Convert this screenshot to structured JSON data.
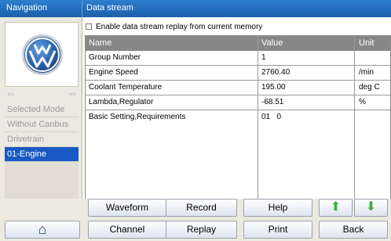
{
  "header": {
    "nav_title": "Navigation",
    "main_title": "Data stream"
  },
  "sidebar": {
    "logo": "vw-logo",
    "items": [
      {
        "label": "Selected Mode",
        "active": false
      },
      {
        "label": "Without Canbus",
        "active": false
      },
      {
        "label": "Drivetrain",
        "active": false
      },
      {
        "label": "01-Engine",
        "active": true
      }
    ]
  },
  "replay_option": {
    "label": "Enable data stream replay from current memory",
    "checked": false
  },
  "table": {
    "columns": [
      "Name",
      "Value",
      "Unit"
    ],
    "rows": [
      {
        "name": "Group Number",
        "value": "1",
        "unit": ""
      },
      {
        "name": "Engine Speed",
        "value": "2760.40",
        "unit": "/min"
      },
      {
        "name": "Coolant Temperature",
        "value": "195.00",
        "unit": "deg C"
      },
      {
        "name": "Lambda,Regulator",
        "value": "-68.51",
        "unit": "%"
      },
      {
        "name": "Basic Setting,Requirements",
        "value": "01   0",
        "unit": ""
      }
    ]
  },
  "buttons": {
    "waveform": "Waveform",
    "record": "Record",
    "help": "Help",
    "channel": "Channel",
    "replay": "Replay",
    "print": "Print",
    "back": "Back",
    "up_glyph": "⬆",
    "down_glyph": "⬇",
    "home_glyph": "⌂"
  },
  "colors": {
    "title_bar": "#1b5fa8",
    "active_item": "#1a59c4",
    "arrow_green": "#38b03a",
    "table_header": "#878787"
  }
}
